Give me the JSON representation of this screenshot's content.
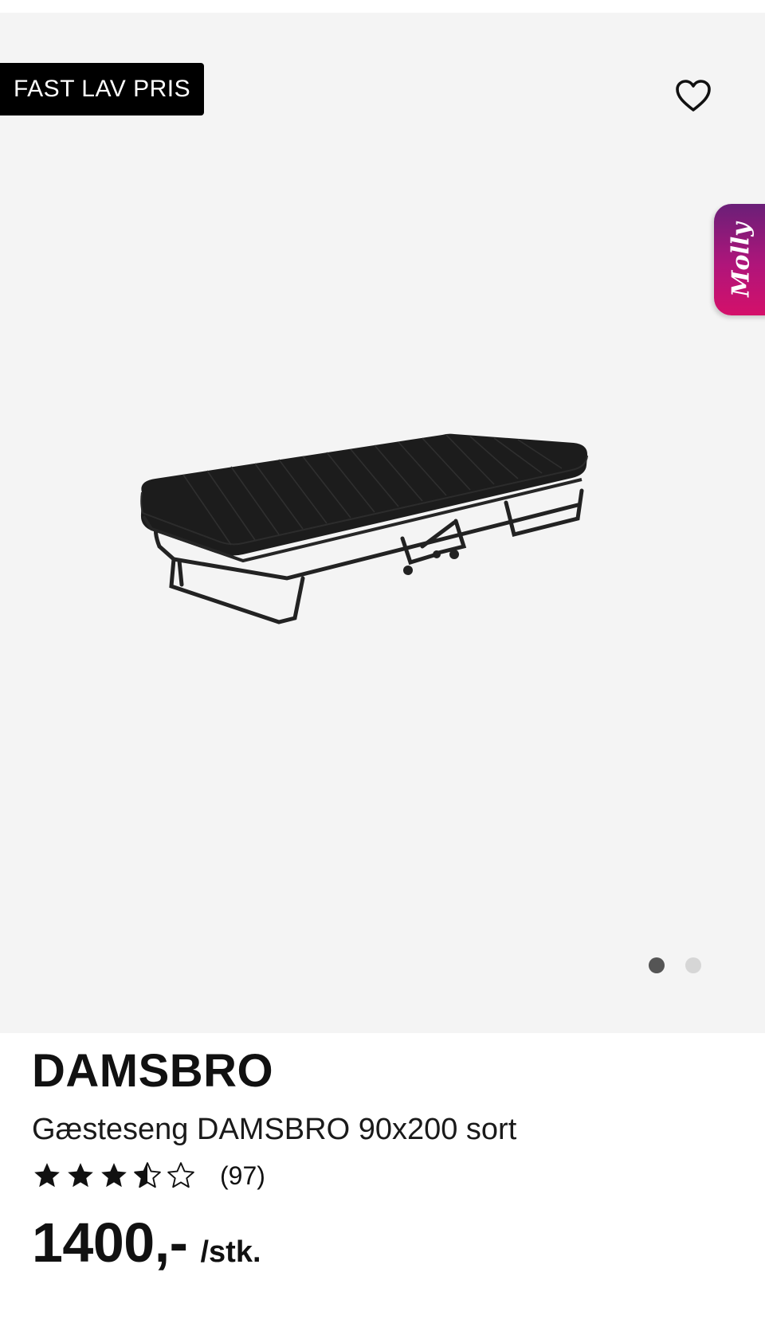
{
  "gallery": {
    "badge": "FAST LAV PRIS",
    "assistant_label": "Molly",
    "image_count": 2,
    "active_image": 1,
    "background_color": "#f4f4f4"
  },
  "icons": {
    "favorite": "heart-outline-icon",
    "rating_full": "star-filled-icon",
    "rating_half": "star-half-icon",
    "rating_empty": "star-outline-icon"
  },
  "product": {
    "brand": "DAMSBRO",
    "name": "Gæsteseng DAMSBRO 90x200 sort",
    "rating": 3.5,
    "rating_max": 5,
    "review_count": "(97)",
    "price": "1400,-",
    "unit": "/stk."
  },
  "colors": {
    "badge_bg": "#000000",
    "assistant_gradient_start": "#6a1f78",
    "assistant_gradient_end": "#d4106a",
    "dot_active": "#555555",
    "dot_inactive": "#d6d6d6"
  }
}
